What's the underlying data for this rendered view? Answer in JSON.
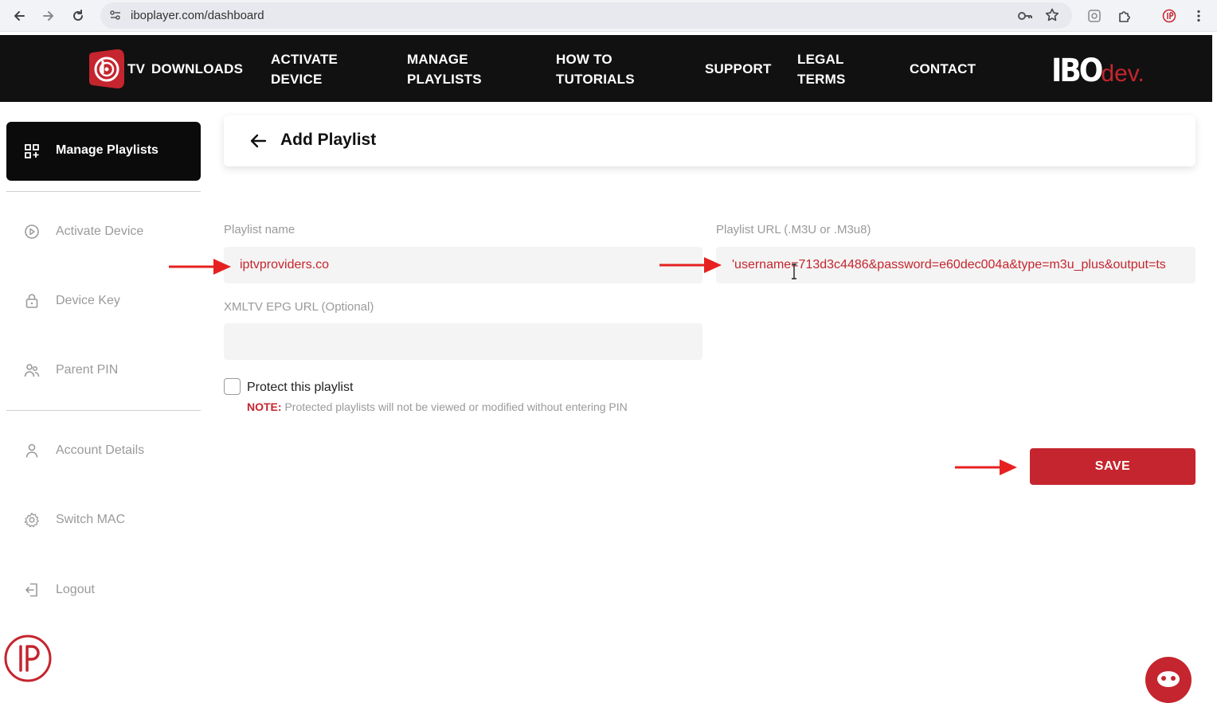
{
  "browser": {
    "url": "iboplayer.com/dashboard"
  },
  "header": {
    "logo_text": "TV",
    "nav": [
      {
        "label_line1": "DOWNLOADS",
        "label_line2": ""
      },
      {
        "label_line1": "ACTIVATE",
        "label_line2": "DEVICE"
      },
      {
        "label_line1": "MANAGE",
        "label_line2": "PLAYLISTS"
      },
      {
        "label_line1": "HOW TO",
        "label_line2": "TUTORIALS"
      },
      {
        "label_line1": "SUPPORT",
        "label_line2": ""
      },
      {
        "label_line1": "LEGAL",
        "label_line2": "TERMS"
      },
      {
        "label_line1": "CONTACT",
        "label_line2": ""
      }
    ],
    "brand": {
      "primary": "IBO",
      "secondary": "dev."
    }
  },
  "sidebar": {
    "active": {
      "label": "Manage Playlists",
      "icon": "grid-icon"
    },
    "items": [
      {
        "label": "Activate Device",
        "icon": "play-circle-icon"
      },
      {
        "label": "Device Key",
        "icon": "lock-icon"
      },
      {
        "label": "Parent PIN",
        "icon": "users-icon"
      },
      {
        "label": "Account Details",
        "icon": "user-icon"
      },
      {
        "label": "Switch MAC",
        "icon": "gear-icon"
      },
      {
        "label": "Logout",
        "icon": "logout-icon"
      }
    ]
  },
  "main": {
    "title": "Add Playlist",
    "playlist_name_label": "Playlist name",
    "playlist_name_value": "iptvproviders.co",
    "playlist_url_label": "Playlist URL (.M3U or .M3u8)",
    "playlist_url_value": "'username=713d3c4486&password=e60dec004a&type=m3u_plus&output=ts",
    "epg_label": "XMLTV EPG URL (Optional)",
    "epg_value": "",
    "protect_label": "Protect this playlist",
    "protect_checked": false,
    "note_key": "NOTE:",
    "note_text": " Protected playlists will not be viewed or modified without entering PIN",
    "save_label": "SAVE"
  },
  "colors": {
    "accent": "#c5252e",
    "header_bg": "#111111"
  }
}
